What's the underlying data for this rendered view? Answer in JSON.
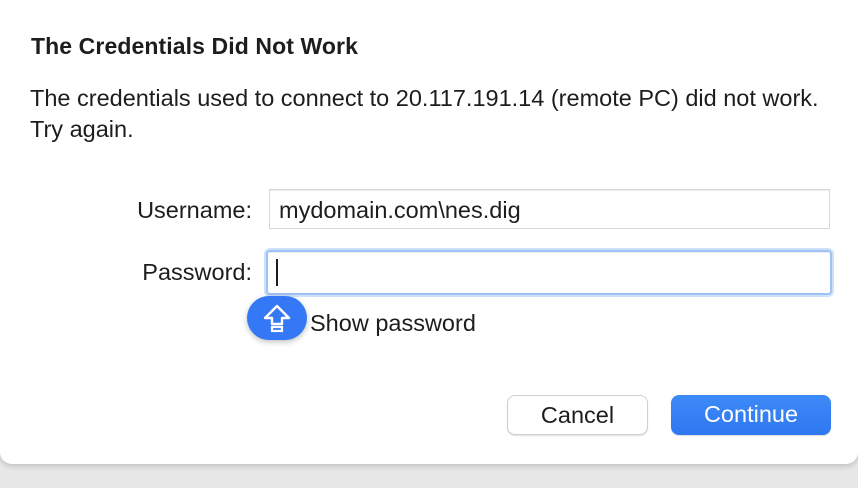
{
  "dialog": {
    "title": "The Credentials Did Not Work",
    "message": "The credentials used to connect to 20.117.191.14 (remote PC) did not work. Try again."
  },
  "form": {
    "username_label": "Username:",
    "username_value": "mydomain.com\\nes.dig",
    "password_label": "Password:",
    "password_value": "",
    "caps_lock_icon": "caps-lock-icon",
    "show_password_label": "Show password"
  },
  "buttons": {
    "cancel_label": "Cancel",
    "continue_label": "Continue"
  },
  "colors": {
    "accent": "#3478f6",
    "focus_ring": "#9fc2f5"
  }
}
